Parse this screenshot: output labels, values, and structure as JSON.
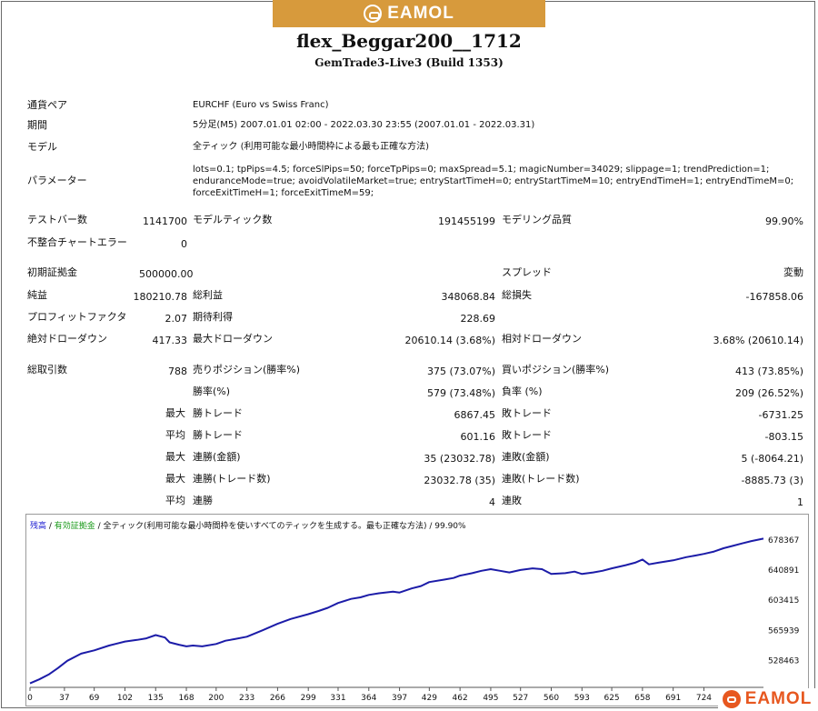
{
  "header": {
    "logo_text": "EAMOL",
    "title": "flex_Beggar200__1712",
    "subtitle": "GemTrade3-Live3 (Build 1353)"
  },
  "info": {
    "symbol_label": "通貨ペア",
    "symbol_value": "EURCHF (Euro vs Swiss Franc)",
    "period_label": "期間",
    "period_value": "5分足(M5) 2007.01.01 02:00 - 2022.03.30 23:55 (2007.01.01 - 2022.03.31)",
    "model_label": "モデル",
    "model_value": "全ティック (利用可能な最小時間枠による最も正確な方法)",
    "params_label": "パラメーター",
    "params_value": "lots=0.1; tpPips=4.5; forceSlPips=50; forceTpPips=0; maxSpread=5.1; magicNumber=34029; slippage=1; trendPrediction=1; enduranceMode=true; avoidVolatileMarket=true; entryStartTimeH=0; entryStartTimeM=10; entryEndTimeH=1; entryEndTimeM=0; forceExitTimeH=1; forceExitTimeM=59;"
  },
  "stats": {
    "bars_label": "テストバー数",
    "bars_value": "1141700",
    "ticks_label": "モデルティック数",
    "ticks_value": "191455199",
    "quality_label": "モデリング品質",
    "quality_value": "99.90%",
    "mismatch_label": "不整合チャートエラー",
    "mismatch_value": "0",
    "deposit_label": "初期証拠金",
    "deposit_value": "500000.00",
    "spread_label": "スプレッド",
    "spread_value": "変動",
    "net_label": "純益",
    "net_value": "180210.78",
    "gross_profit_label": "総利益",
    "gross_profit_value": "348068.84",
    "gross_loss_label": "総損失",
    "gross_loss_value": "-167858.06",
    "pf_label": "プロフィットファクタ",
    "pf_value": "2.07",
    "payoff_label": "期待利得",
    "payoff_value": "228.69",
    "abs_dd_label": "絶対ドローダウン",
    "abs_dd_value": "417.33",
    "max_dd_label": "最大ドローダウン",
    "max_dd_value": "20610.14 (3.68%)",
    "rel_dd_label": "相対ドローダウン",
    "rel_dd_value": "3.68% (20610.14)",
    "trades_label": "総取引数",
    "trades_value": "788",
    "short_label": "売りポジション(勝率%)",
    "short_value": "375 (73.07%)",
    "long_label": "買いポジション(勝率%)",
    "long_value": "413 (73.85%)",
    "win_label": "勝率(%)",
    "win_value": "579 (73.48%)",
    "loss_label": "負率 (%)",
    "loss_value": "209 (26.52%)",
    "largest": "最大",
    "average": "平均",
    "maximum": "最大",
    "maximal": "最大",
    "avg2": "平均",
    "largest_win_label": "勝トレード",
    "largest_win_value": "6867.45",
    "largest_loss_label": "敗トレード",
    "largest_loss_value": "-6731.25",
    "avg_win_label": "勝トレード",
    "avg_win_value": "601.16",
    "avg_loss_label": "敗トレード",
    "avg_loss_value": "-803.15",
    "cons_wins_label": "連勝(金額)",
    "cons_wins_value": "35 (23032.78)",
    "cons_losses_label": "連敗(金額)",
    "cons_losses_value": "5 (-8064.21)",
    "cons_profit_label": "連勝(トレード数)",
    "cons_profit_value": "23032.78 (35)",
    "cons_loss_label": "連敗(トレード数)",
    "cons_loss_value": "-8885.73 (3)",
    "avg_cons_wins_label": "連勝",
    "avg_cons_wins_value": "4",
    "avg_cons_losses_label": "連敗",
    "avg_cons_losses_value": "1"
  },
  "chart_legend": {
    "balance": "残高",
    "sep1": " / ",
    "equity": "有効証拠金",
    "rest": " / 全ティック(利用可能な最小時間枠を使いすべてのティックを生成する。最も正確な方法) / 99.90%"
  },
  "chart_data": {
    "type": "line",
    "x_ticks": [
      0,
      37,
      69,
      102,
      135,
      168,
      200,
      233,
      266,
      299,
      331,
      364,
      397,
      429,
      462,
      495,
      527,
      560,
      593,
      625,
      658,
      691,
      724
    ],
    "y_ticks": [
      528463,
      565939,
      603415,
      640891,
      678367
    ],
    "ylim": [
      495000,
      685000
    ],
    "xlim": [
      0,
      788
    ],
    "series": [
      {
        "x": [
          0,
          10,
          20,
          30,
          40,
          55,
          69,
          85,
          102,
          115,
          125,
          135,
          145,
          150,
          160,
          168,
          175,
          185,
          200,
          210,
          220,
          233,
          250,
          266,
          280,
          299,
          310,
          320,
          331,
          345,
          355,
          364,
          375,
          390,
          397,
          410,
          420,
          429,
          445,
          455,
          462,
          475,
          485,
          495,
          505,
          515,
          527,
          540,
          550,
          560,
          575,
          585,
          593,
          605,
          615,
          625,
          640,
          650,
          658,
          665,
          675,
          691,
          705,
          715,
          724,
          735,
          745,
          755,
          765,
          775,
          788
        ],
        "y": [
          500000,
          505000,
          511000,
          519000,
          528000,
          537000,
          541000,
          547000,
          552000,
          554000,
          556000,
          560000,
          557000,
          551000,
          548000,
          546000,
          547000,
          546000,
          549000,
          553000,
          555000,
          558000,
          566000,
          574000,
          580000,
          586000,
          590000,
          594000,
          600000,
          605000,
          607000,
          610000,
          612000,
          614000,
          613000,
          618000,
          621000,
          626000,
          629000,
          631000,
          634000,
          637000,
          640000,
          642000,
          640000,
          638000,
          641000,
          643000,
          642000,
          636000,
          637000,
          639000,
          636000,
          638000,
          640000,
          643000,
          647000,
          650000,
          654000,
          648000,
          650000,
          653000,
          657000,
          659000,
          661000,
          664000,
          668000,
          671000,
          674000,
          677000,
          680000
        ]
      }
    ]
  }
}
